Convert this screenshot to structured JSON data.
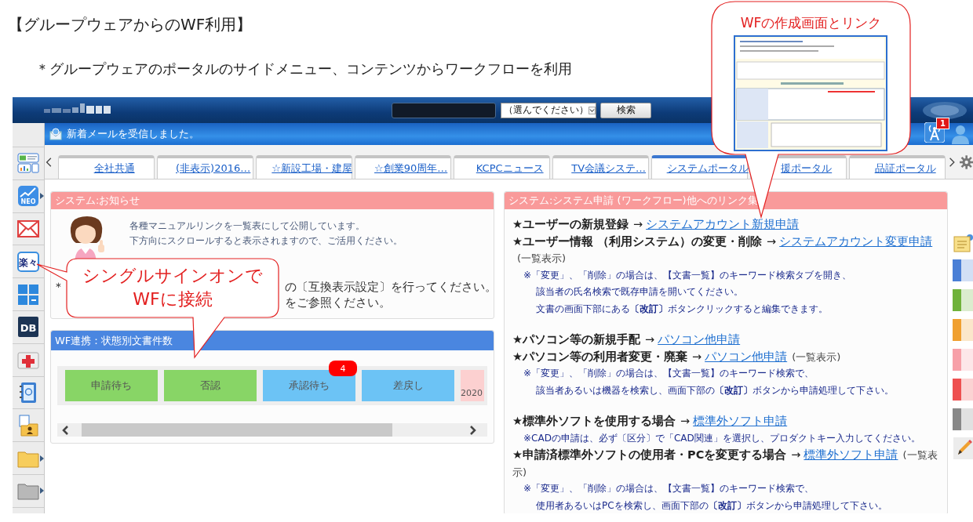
{
  "title": "【グループウェアからのWF利用】",
  "subtitle": "＊グループウェアのポータルのサイドメニュー、コンテンツからワークフローを利用",
  "portal": {
    "header": {
      "select": "（選んでください）",
      "search_button": "検索"
    },
    "notice_bar": {
      "message": "新着メールを受信しました。",
      "alert_badge": "1"
    },
    "sidebar": [
      {
        "kind": "dashboard",
        "submenu": false
      },
      {
        "kind": "neo",
        "label": "NEO",
        "submenu": true
      },
      {
        "kind": "mail",
        "submenu": false
      },
      {
        "kind": "raku",
        "label": "楽々",
        "submenu": false
      },
      {
        "kind": "tiles",
        "submenu": false
      },
      {
        "kind": "db",
        "label": "DB",
        "submenu": false
      },
      {
        "kind": "firstaid",
        "submenu": false
      },
      {
        "kind": "addressbook",
        "submenu": false
      },
      {
        "kind": "folder-user",
        "submenu": false
      },
      {
        "kind": "folder",
        "submenu": true
      },
      {
        "kind": "folder-gray",
        "submenu": true
      }
    ],
    "tabs": [
      {
        "label": "全社共通",
        "selected": false
      },
      {
        "label": "(非表示)2016…",
        "selected": false
      },
      {
        "label": "☆新設工場・建屋",
        "selected": false
      },
      {
        "label": "☆創業90周年…",
        "selected": false
      },
      {
        "label": "KCPCニュース",
        "selected": false
      },
      {
        "label": "TV会議システ…",
        "selected": false
      },
      {
        "label": "システムポータル",
        "selected": true
      },
      {
        "label": "援ポータル",
        "selected": false
      },
      {
        "label": "品証ポータル",
        "selected": false
      }
    ],
    "notice_panel": {
      "title": "システム:お知らせ",
      "lines": [
        "各種マニュアルリンクを一覧表にして公開しています。",
        "下方向にスクロールすると表示されますので、ご活用ください。"
      ],
      "partial_lines": [
        {
          "left": "＊",
          "right": "の〔互換表示設定〕を行ってください。"
        },
        {
          "right": "をご参照ください。"
        }
      ]
    },
    "wf_panel": {
      "title": "WF連携：状態別文書件数",
      "tiles": [
        {
          "kind": "status",
          "label": "申請待ち",
          "color": "#88d566"
        },
        {
          "kind": "status",
          "label": "否認",
          "color": "#88d566"
        },
        {
          "kind": "status",
          "label": "承認待ち",
          "color": "#6cc3f5",
          "badge": "4"
        },
        {
          "kind": "status",
          "label": "差戻し",
          "color": "#6cc3f5"
        },
        {
          "kind": "date",
          "label": "2020",
          "color": "#fcd0d0"
        }
      ]
    },
    "links_panel": {
      "title": "システム:システム申請 (ワークフロー)他へのリンク集",
      "lines": [
        {
          "kind": "entry",
          "label": "★ユーザーの新規登録",
          "arrow": "→",
          "link": "システムアカウント新規申請"
        },
        {
          "kind": "entry",
          "label": "★ユーザー情報 （利用システム）の変更・削除",
          "arrow": "→",
          "link": "システムアカウント変更申請",
          "suffix": "(一覧表示)"
        },
        {
          "kind": "note",
          "text": "※「変更」、「削除」の場合は、【文書一覧】のキーワード検索タブを開き、"
        },
        {
          "kind": "note",
          "text": "該当者の氏名検索で既存申請を開いてください。"
        },
        {
          "kind": "note",
          "text": "文書の画面下部にある**〔改訂〕**ボタンクリックすると編集できます。"
        },
        {
          "kind": "gap"
        },
        {
          "kind": "entry",
          "label": "★パソコン等の新規手配",
          "arrow": "→",
          "link": "パソコン他申請"
        },
        {
          "kind": "entry",
          "label": "★パソコン等の利用者変更・廃棄",
          "arrow": "→",
          "link": "パソコン他申請",
          "suffix": "(一覧表示)"
        },
        {
          "kind": "note",
          "text": "※「変更」、「削除」の場合は、【文書一覧】のキーワード検索で、"
        },
        {
          "kind": "note",
          "text": "該当者あるいは機器を検索し、画面下部の**〔改訂〕**ボタンから申請処理して下さい。"
        },
        {
          "kind": "gap"
        },
        {
          "kind": "entry",
          "label": "★標準外ソフトを使用する場合",
          "arrow": "→",
          "link": "標準外ソフト申請"
        },
        {
          "kind": "note",
          "text": "※CADの申請は、必ず〔区分〕で「CAD関連」を選択し、プロダクトキー入力してください。"
        },
        {
          "kind": "entry",
          "label": "★申請済標準外ソフトの使用者・PCを変更する場合",
          "arrow": "→",
          "link": "標準外ソフト申請",
          "suffix": "(一覧表示)"
        },
        {
          "kind": "note",
          "text": "※「変更」、「削除」の場合は、【文書一覧】のキーワード検索で、"
        },
        {
          "kind": "note",
          "text": "使用者あるいはPCを検索し、画面下部の**〔改訂〕**ボタンから申請処理して下さい。"
        }
      ]
    },
    "right_tools": [
      {
        "kind": "note"
      },
      {
        "kind": "tab",
        "color": "#4a7fd6"
      },
      {
        "kind": "tab",
        "color": "#6fb23a"
      },
      {
        "kind": "tab",
        "color": "#f0a030"
      },
      {
        "kind": "tab",
        "color": "#f7a0a8"
      },
      {
        "kind": "tab",
        "color": "#ee5050"
      },
      {
        "kind": "tab",
        "color": "#888888"
      },
      {
        "kind": "pencil"
      }
    ]
  },
  "callouts": [
    {
      "kind": "screen-link",
      "lines": [
        "WFの作成画面とリンク"
      ]
    },
    {
      "kind": "note",
      "lines": [
        "シングルサインオンで",
        "WFに接続"
      ]
    }
  ]
}
